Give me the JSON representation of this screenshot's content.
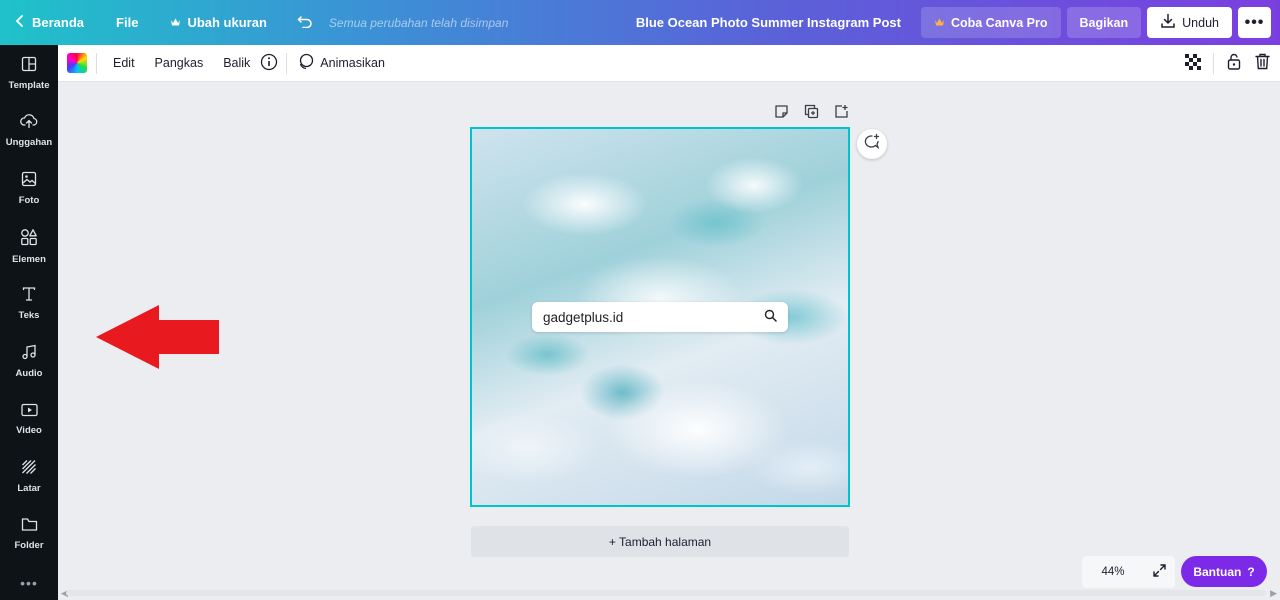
{
  "topbar": {
    "home_label": "Beranda",
    "file_label": "File",
    "resize_label": "Ubah ukuran",
    "saved_status": "Semua perubahan telah disimpan",
    "doc_title": "Blue Ocean Photo Summer Instagram Post",
    "pro_label": "Coba Canva Pro",
    "share_label": "Bagikan",
    "download_label": "Unduh",
    "more_label": "•••",
    "gradient_colors": [
      "#1fc2c9",
      "#3d8fd6",
      "#5a62d8",
      "#7b3fe0"
    ]
  },
  "sidebar": {
    "items": [
      {
        "label": "Template",
        "icon": "template-icon"
      },
      {
        "label": "Unggahan",
        "icon": "upload-cloud-icon"
      },
      {
        "label": "Foto",
        "icon": "photo-icon"
      },
      {
        "label": "Elemen",
        "icon": "elements-icon"
      },
      {
        "label": "Teks",
        "icon": "text-icon"
      },
      {
        "label": "Audio",
        "icon": "music-note-icon"
      },
      {
        "label": "Video",
        "icon": "video-icon"
      },
      {
        "label": "Latar",
        "icon": "background-pattern-icon"
      },
      {
        "label": "Folder",
        "icon": "folder-icon"
      }
    ],
    "more_label": "•••"
  },
  "toolbar": {
    "edit_label": "Edit",
    "crop_label": "Pangkas",
    "flip_label": "Balik",
    "animate_label": "Animasikan"
  },
  "canvas": {
    "search_text": "gadgetplus.id",
    "add_page_label": "+ Tambah halaman",
    "accent_color": "#00c4cc"
  },
  "footer": {
    "zoom_level": "44%",
    "help_label": "Bantuan",
    "help_icon_label": "?",
    "help_color": "#7d2ae8"
  },
  "annotation": {
    "arrow_color": "#e8191f"
  }
}
